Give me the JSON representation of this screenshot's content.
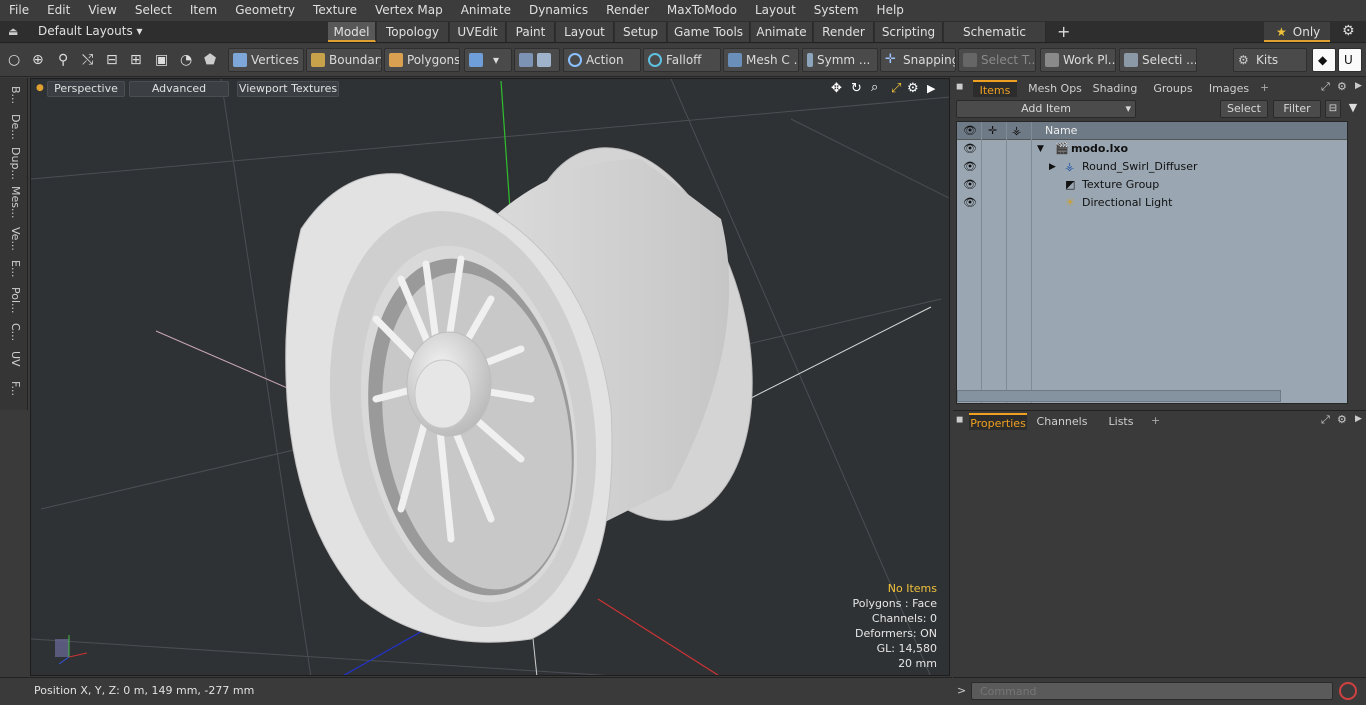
{
  "menu": [
    "File",
    "Edit",
    "View",
    "Select",
    "Item",
    "Geometry",
    "Texture",
    "Vertex Map",
    "Animate",
    "Dynamics",
    "Render",
    "MaxToModo",
    "Layout",
    "System",
    "Help"
  ],
  "layout_selector": "Default Layouts ▾",
  "layout_tabs": [
    "Model",
    "Topology",
    "UVEdit",
    "Paint",
    "Layout",
    "Setup",
    "Game Tools",
    "Animate",
    "Render",
    "Scripting",
    "Schematic Fusion"
  ],
  "only_label": "Only",
  "toolbar": {
    "vertices": "Vertices",
    "boundary": "Boundary",
    "polygons": "Polygons",
    "action": "Action",
    "falloff": "Falloff",
    "mesh": "Mesh C ...",
    "symm": "Symm ...",
    "snapping": "Snapping",
    "select_t": "Select T...",
    "workpl": "Work Pl...",
    "selecti": "Selecti ...",
    "kits": "Kits"
  },
  "left_tabs": [
    "B...",
    "De...",
    "Dup...",
    "Mes...",
    "Ve...",
    "E...",
    "Pol...",
    "C...",
    "UV",
    "F..."
  ],
  "viewport": {
    "perspective": "Perspective",
    "advanced": "Advanced",
    "textures": "Viewport Textures",
    "stats": {
      "no_items": "No Items",
      "polygons": "Polygons : Face",
      "channels": "Channels: 0",
      "deformers": "Deformers: ON",
      "gl": "GL: 14,580",
      "unit": "20 mm"
    }
  },
  "status": {
    "position": "Position X, Y, Z:   0 m, 149 mm, -277 mm"
  },
  "items_panel": {
    "tabs": [
      "Items",
      "Mesh Ops",
      "Shading",
      "Groups",
      "Images"
    ],
    "add_item": "Add Item",
    "select": "Select",
    "filter": "Filter",
    "name_col": "Name",
    "items": [
      "modo.lxo",
      "Round_Swirl_Diffuser",
      "Texture Group",
      "Directional Light"
    ]
  },
  "props_panel": {
    "tabs": [
      "Properties",
      "Channels",
      "Lists"
    ]
  },
  "command": {
    "placeholder": "Command"
  },
  "colors": {
    "accent": "#f0a020",
    "viewport_bg": "#2f3235",
    "list_bg": "#9aa7b2"
  }
}
